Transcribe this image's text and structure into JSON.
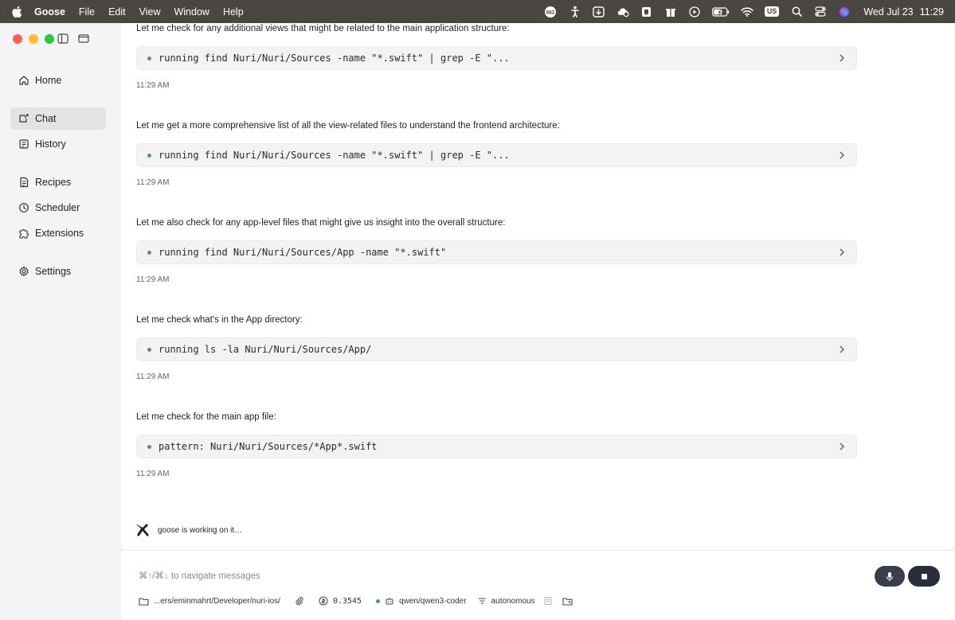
{
  "menubar": {
    "app_name": "Goose",
    "menus": [
      "File",
      "Edit",
      "View",
      "Window",
      "Help"
    ],
    "badge_count": "682",
    "keyboard_layout": "US",
    "date": "Wed Jul 23",
    "time": "11:29"
  },
  "sidebar": {
    "items": [
      {
        "label": "Home",
        "icon": "home-icon"
      },
      {
        "label": "Chat",
        "icon": "chat-icon",
        "active": true
      },
      {
        "label": "History",
        "icon": "history-icon"
      },
      {
        "label": "Recipes",
        "icon": "recipes-icon"
      },
      {
        "label": "Scheduler",
        "icon": "scheduler-icon"
      },
      {
        "label": "Extensions",
        "icon": "extensions-icon"
      },
      {
        "label": "Settings",
        "icon": "gear-icon"
      }
    ]
  },
  "messages": [
    {
      "text": "Let me check for any additional views that might be related to the main application structure:",
      "command": "running find Nuri/Nuri/Sources -name \"*.swift\" | grep -E \"...",
      "time": "11:29 AM"
    },
    {
      "text": "Let me get a more comprehensive list of all the view-related files to understand the frontend architecture:",
      "command": "running find Nuri/Nuri/Sources -name \"*.swift\" | grep -E \"...",
      "time": "11:29 AM"
    },
    {
      "text": "Let me also check for any app-level files that might give us insight into the overall structure:",
      "command": "running find Nuri/Nuri/Sources/App -name \"*.swift\"",
      "time": "11:29 AM"
    },
    {
      "text": "Let me check what's in the App directory:",
      "command": "running ls -la Nuri/Nuri/Sources/App/",
      "time": "11:29 AM"
    },
    {
      "text": "Let me check for the main app file:",
      "command": "pattern: Nuri/Nuri/Sources/*App*.swift",
      "time": "11:29 AM"
    }
  ],
  "status": {
    "working_text": "goose is working on it…"
  },
  "input": {
    "placeholder": "⌘↑/⌘↓ to navigate messages",
    "path": "...ers/eminmahrt/Developer/nuri-ios/",
    "cost": "0.3545",
    "model": "qwen/qwen3-coder",
    "mode": "autonomous"
  },
  "colors": {
    "active_dot": "#3fa35b",
    "send_button": "#2a2d3a",
    "menubar": "#4a4640"
  }
}
